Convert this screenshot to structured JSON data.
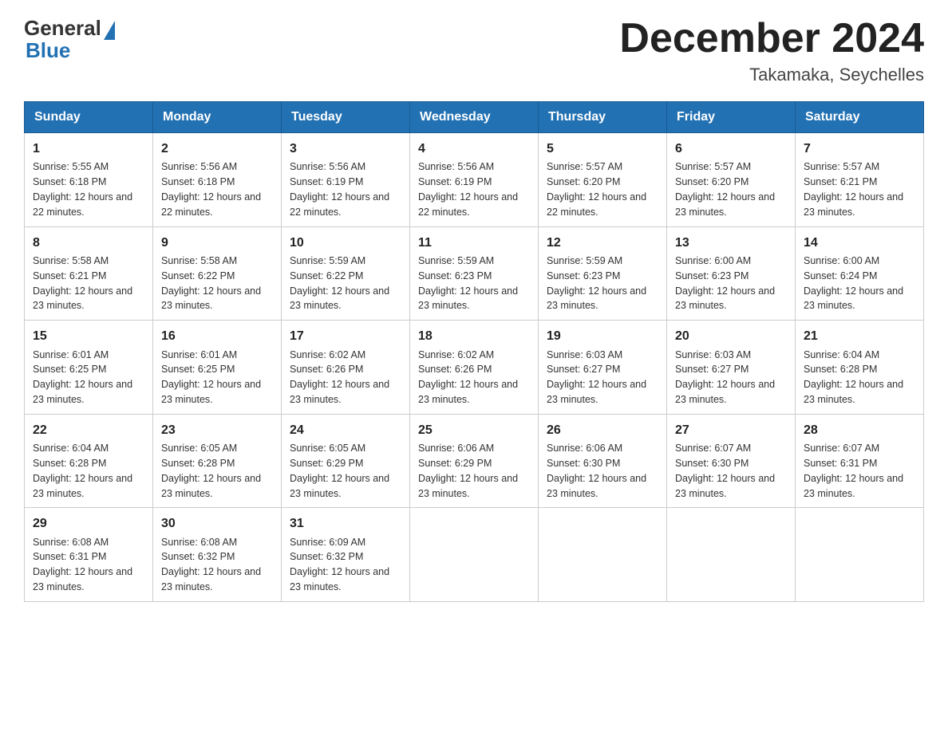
{
  "header": {
    "logo_general": "General",
    "logo_blue": "Blue",
    "month_title": "December 2024",
    "location": "Takamaka, Seychelles"
  },
  "weekdays": [
    "Sunday",
    "Monday",
    "Tuesday",
    "Wednesday",
    "Thursday",
    "Friday",
    "Saturday"
  ],
  "weeks": [
    [
      {
        "day": "1",
        "sunrise": "5:55 AM",
        "sunset": "6:18 PM",
        "daylight": "12 hours and 22 minutes."
      },
      {
        "day": "2",
        "sunrise": "5:56 AM",
        "sunset": "6:18 PM",
        "daylight": "12 hours and 22 minutes."
      },
      {
        "day": "3",
        "sunrise": "5:56 AM",
        "sunset": "6:19 PM",
        "daylight": "12 hours and 22 minutes."
      },
      {
        "day": "4",
        "sunrise": "5:56 AM",
        "sunset": "6:19 PM",
        "daylight": "12 hours and 22 minutes."
      },
      {
        "day": "5",
        "sunrise": "5:57 AM",
        "sunset": "6:20 PM",
        "daylight": "12 hours and 22 minutes."
      },
      {
        "day": "6",
        "sunrise": "5:57 AM",
        "sunset": "6:20 PM",
        "daylight": "12 hours and 23 minutes."
      },
      {
        "day": "7",
        "sunrise": "5:57 AM",
        "sunset": "6:21 PM",
        "daylight": "12 hours and 23 minutes."
      }
    ],
    [
      {
        "day": "8",
        "sunrise": "5:58 AM",
        "sunset": "6:21 PM",
        "daylight": "12 hours and 23 minutes."
      },
      {
        "day": "9",
        "sunrise": "5:58 AM",
        "sunset": "6:22 PM",
        "daylight": "12 hours and 23 minutes."
      },
      {
        "day": "10",
        "sunrise": "5:59 AM",
        "sunset": "6:22 PM",
        "daylight": "12 hours and 23 minutes."
      },
      {
        "day": "11",
        "sunrise": "5:59 AM",
        "sunset": "6:23 PM",
        "daylight": "12 hours and 23 minutes."
      },
      {
        "day": "12",
        "sunrise": "5:59 AM",
        "sunset": "6:23 PM",
        "daylight": "12 hours and 23 minutes."
      },
      {
        "day": "13",
        "sunrise": "6:00 AM",
        "sunset": "6:23 PM",
        "daylight": "12 hours and 23 minutes."
      },
      {
        "day": "14",
        "sunrise": "6:00 AM",
        "sunset": "6:24 PM",
        "daylight": "12 hours and 23 minutes."
      }
    ],
    [
      {
        "day": "15",
        "sunrise": "6:01 AM",
        "sunset": "6:25 PM",
        "daylight": "12 hours and 23 minutes."
      },
      {
        "day": "16",
        "sunrise": "6:01 AM",
        "sunset": "6:25 PM",
        "daylight": "12 hours and 23 minutes."
      },
      {
        "day": "17",
        "sunrise": "6:02 AM",
        "sunset": "6:26 PM",
        "daylight": "12 hours and 23 minutes."
      },
      {
        "day": "18",
        "sunrise": "6:02 AM",
        "sunset": "6:26 PM",
        "daylight": "12 hours and 23 minutes."
      },
      {
        "day": "19",
        "sunrise": "6:03 AM",
        "sunset": "6:27 PM",
        "daylight": "12 hours and 23 minutes."
      },
      {
        "day": "20",
        "sunrise": "6:03 AM",
        "sunset": "6:27 PM",
        "daylight": "12 hours and 23 minutes."
      },
      {
        "day": "21",
        "sunrise": "6:04 AM",
        "sunset": "6:28 PM",
        "daylight": "12 hours and 23 minutes."
      }
    ],
    [
      {
        "day": "22",
        "sunrise": "6:04 AM",
        "sunset": "6:28 PM",
        "daylight": "12 hours and 23 minutes."
      },
      {
        "day": "23",
        "sunrise": "6:05 AM",
        "sunset": "6:28 PM",
        "daylight": "12 hours and 23 minutes."
      },
      {
        "day": "24",
        "sunrise": "6:05 AM",
        "sunset": "6:29 PM",
        "daylight": "12 hours and 23 minutes."
      },
      {
        "day": "25",
        "sunrise": "6:06 AM",
        "sunset": "6:29 PM",
        "daylight": "12 hours and 23 minutes."
      },
      {
        "day": "26",
        "sunrise": "6:06 AM",
        "sunset": "6:30 PM",
        "daylight": "12 hours and 23 minutes."
      },
      {
        "day": "27",
        "sunrise": "6:07 AM",
        "sunset": "6:30 PM",
        "daylight": "12 hours and 23 minutes."
      },
      {
        "day": "28",
        "sunrise": "6:07 AM",
        "sunset": "6:31 PM",
        "daylight": "12 hours and 23 minutes."
      }
    ],
    [
      {
        "day": "29",
        "sunrise": "6:08 AM",
        "sunset": "6:31 PM",
        "daylight": "12 hours and 23 minutes."
      },
      {
        "day": "30",
        "sunrise": "6:08 AM",
        "sunset": "6:32 PM",
        "daylight": "12 hours and 23 minutes."
      },
      {
        "day": "31",
        "sunrise": "6:09 AM",
        "sunset": "6:32 PM",
        "daylight": "12 hours and 23 minutes."
      },
      null,
      null,
      null,
      null
    ]
  ]
}
